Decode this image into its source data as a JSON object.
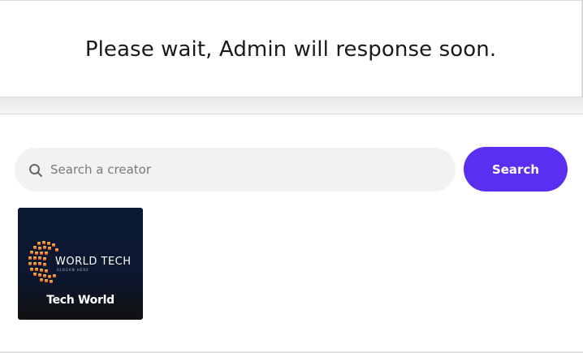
{
  "notice": {
    "message": "Please wait, Admin will response soon."
  },
  "search": {
    "placeholder": "Search a creator",
    "value": "",
    "icon": "search-icon",
    "button_label": "Search",
    "button_color": "#5b2ff2"
  },
  "creators": [
    {
      "name": "Tech World",
      "logo_text": "WORLD TECH",
      "logo_slogan": "SLOGAN HERE"
    }
  ]
}
